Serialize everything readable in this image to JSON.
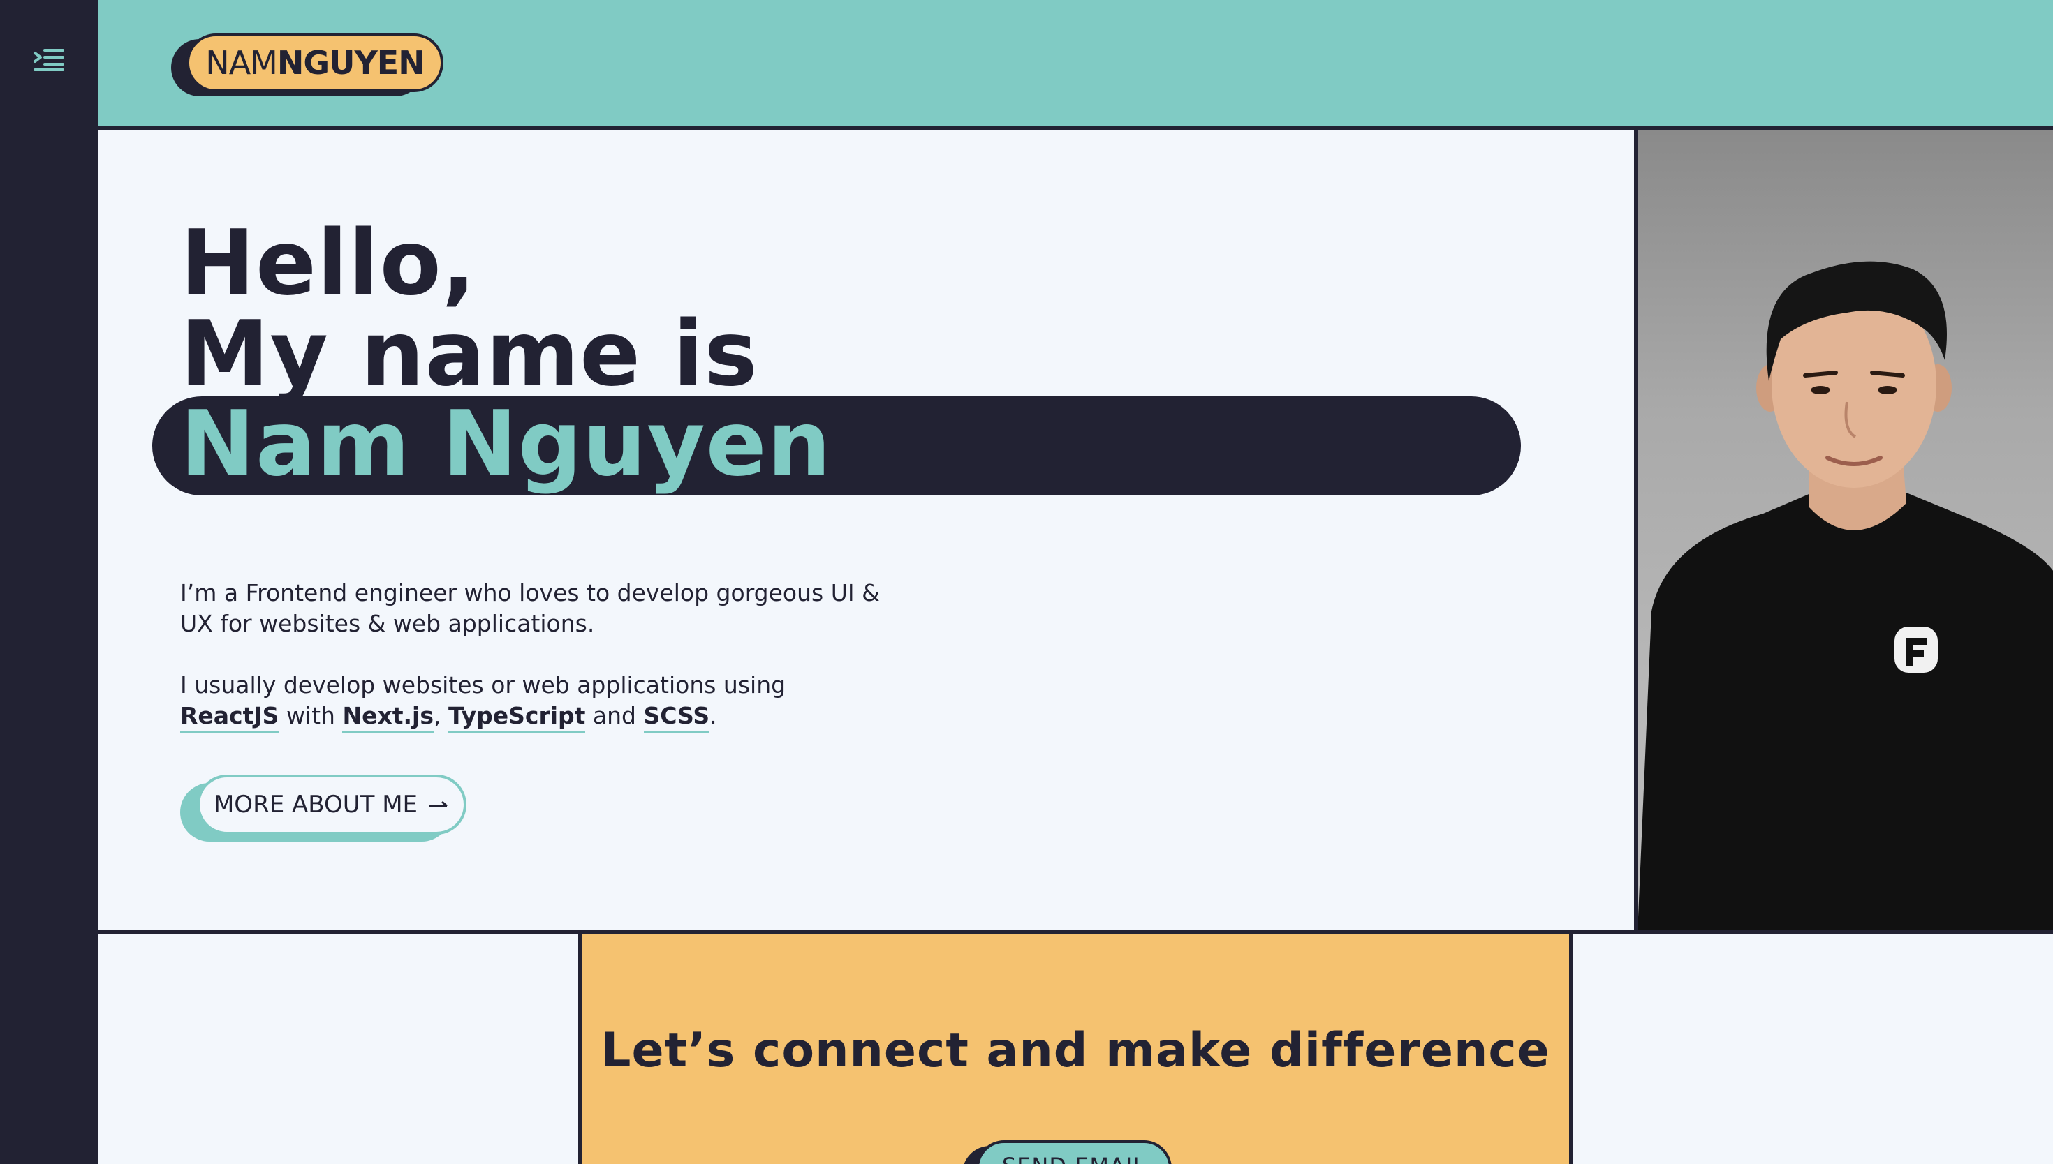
{
  "colors": {
    "sidebar": "#222233",
    "teal": "#80cbc4",
    "yellow": "#f5c270",
    "background": "#f3f7fc",
    "ink": "#222233"
  },
  "sidebar": {
    "menu_icon": "indent-menu-icon"
  },
  "header": {
    "logo_first": "NAM",
    "logo_last": "NGUYEN"
  },
  "hero": {
    "greeting_line1": "Hello,",
    "greeting_line2": "My name is",
    "name": "Nam Nguyen",
    "intro_line1": "I’m a Frontend engineer who loves to develop gorgeous UI &",
    "intro_line2": "UX for websites & web applications.",
    "stack_line1": "I usually develop websites or web applications using",
    "stack": {
      "tech1": "ReactJS",
      "word_with": " with ",
      "tech2": "Next.js",
      "comma": ", ",
      "tech3": "TypeScript",
      "word_and": " and ",
      "tech4": "SCSS",
      "period": "."
    },
    "more_button_label": "MORE ABOUT ME",
    "more_button_icon": "arrow-right-icon",
    "photo_alt": "Portrait of Nam Nguyen"
  },
  "cta": {
    "title": "Let’s connect and make difference",
    "send_button_label": "SEND EMAIL"
  }
}
